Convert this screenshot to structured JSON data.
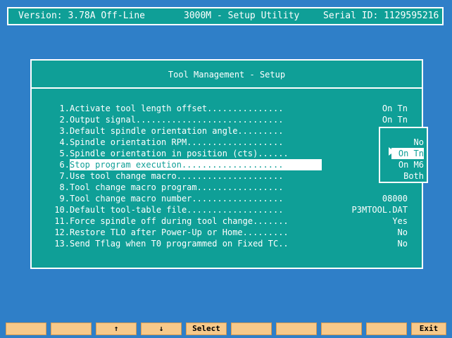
{
  "header": {
    "version": "Version: 3.78A Off-Line",
    "app": "3000M - Setup Utility",
    "serial": "Serial ID: 1129595216"
  },
  "panel": {
    "title": "Tool Management - Setup",
    "rows": [
      {
        "num": "1.",
        "label": "Activate tool length offset...............",
        "value": "On Tn"
      },
      {
        "num": "2.",
        "label": "Output signal.............................",
        "value": "On Tn"
      },
      {
        "num": "3.",
        "label": "Default spindle orientation angle.........",
        "value": ""
      },
      {
        "num": "4.",
        "label": "Spindle orientation RPM...................",
        "value": ""
      },
      {
        "num": "5.",
        "label": "Spindle orientation in position (cts)......",
        "value": ""
      },
      {
        "num": "6.",
        "label": "Stop program execution....................",
        "value": ""
      },
      {
        "num": "7.",
        "label": "Use tool change macro.....................",
        "value": ""
      },
      {
        "num": "8.",
        "label": "Tool change macro program.................",
        "value": ""
      },
      {
        "num": "9.",
        "label": "Tool change macro number..................",
        "value": "08000"
      },
      {
        "num": "10.",
        "label": "Default tool-table file...................",
        "value": "P3MTOOL.DAT"
      },
      {
        "num": "11.",
        "label": "Force spindle off during tool change.......",
        "value": "Yes"
      },
      {
        "num": "12.",
        "label": "Restore TLO after Power-Up or Home.........",
        "value": "No"
      },
      {
        "num": "13.",
        "label": "Send Tflag when T0 programmed on Fixed TC..",
        "value": "No"
      }
    ]
  },
  "dropdown": {
    "options": [
      "No",
      "On Tn",
      "On M6",
      "Both"
    ],
    "selected": "On Tn"
  },
  "function_keys": [
    "",
    "",
    "↑",
    "↓",
    "Select",
    "",
    "",
    "",
    "",
    "Exit"
  ],
  "colors": {
    "background": "#2f7fc8",
    "panel": "#0f9f97",
    "text": "#ffffff",
    "function_key": "#f7c98a"
  }
}
